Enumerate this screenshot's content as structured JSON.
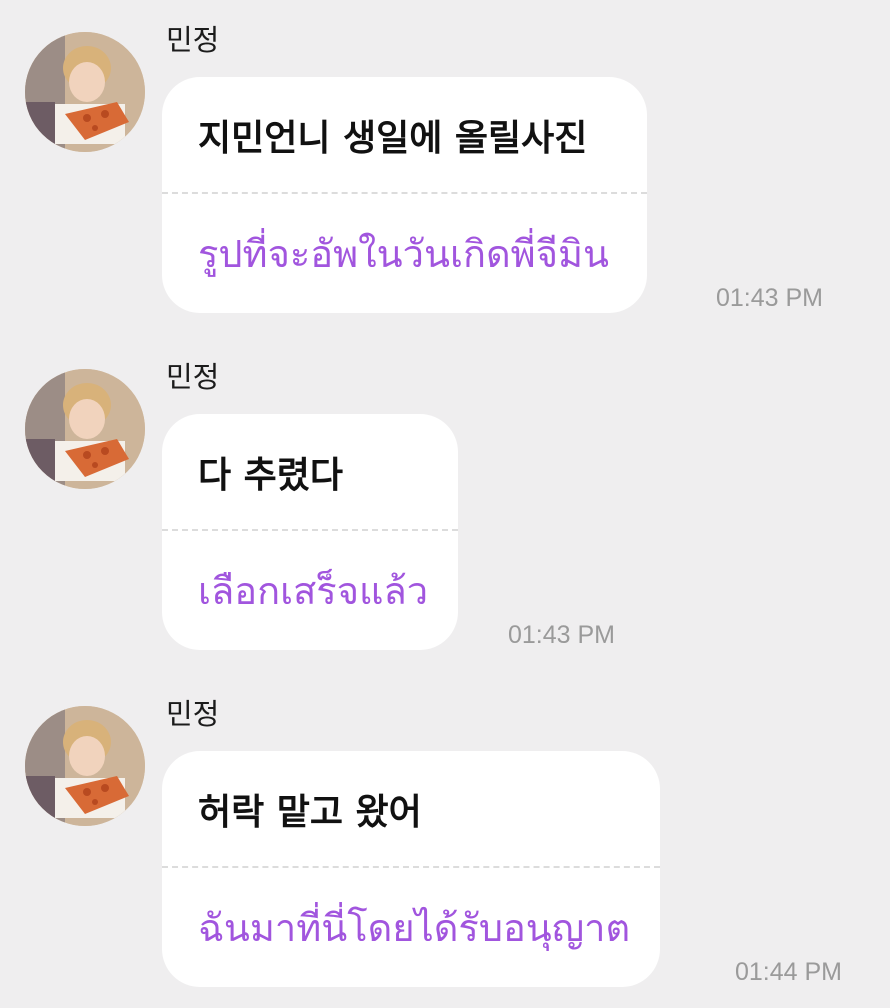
{
  "messages": [
    {
      "sender": "민정",
      "korean": "지민언니 생일에 올릴사진",
      "thai": "รูปที่จะอัพในวันเกิดพี่จีมิน",
      "time": "01:43 PM"
    },
    {
      "sender": "민정",
      "korean": "다 추렸다",
      "thai": "เลือกเสร็จแล้ว",
      "time": "01:43 PM"
    },
    {
      "sender": "민정",
      "korean": "허락 맡고 왔어",
      "thai": "ฉันมาที่นี่โดยได้รับอนุญาต",
      "time": "01:44 PM"
    }
  ],
  "colors": {
    "background": "#efeeef",
    "bubble": "#ffffff",
    "korean_text": "#111111",
    "thai_text": "#a155de",
    "timestamp": "#9a9a9a"
  }
}
